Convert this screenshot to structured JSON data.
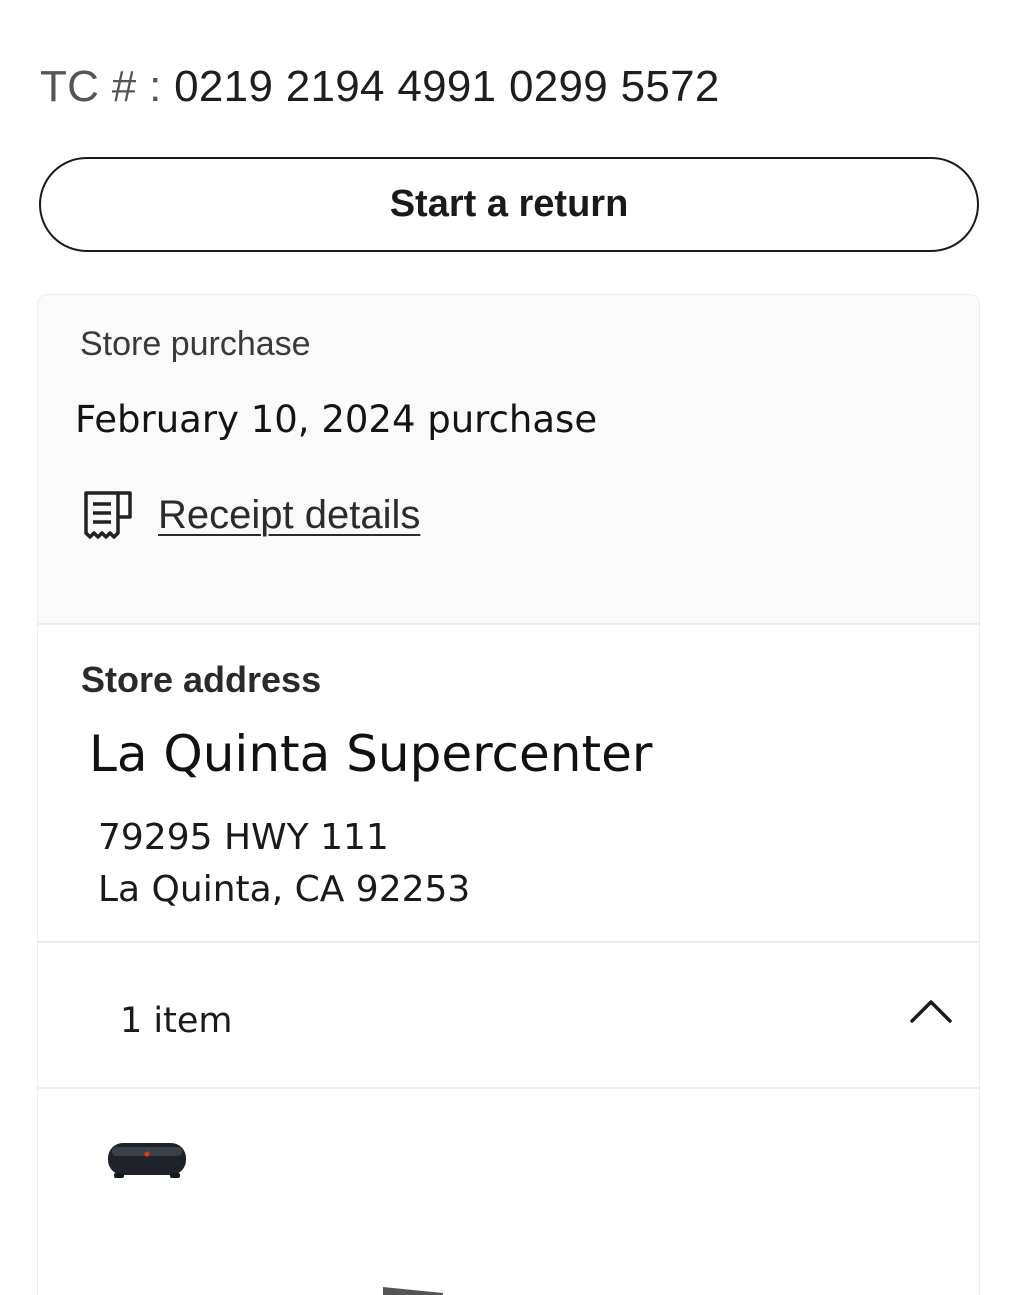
{
  "transaction": {
    "tc_label": "TC # :",
    "tc_number": "0219 2194 4991 0299 5572"
  },
  "actions": {
    "start_return_label": "Start a return"
  },
  "purchase": {
    "type_label": "Store purchase",
    "date_text": "February 10, 2024 purchase",
    "receipt_link_label": "Receipt details",
    "receipt_icon": "receipt-icon"
  },
  "store": {
    "section_label": "Store address",
    "name": "La Quinta Supercenter",
    "address_line1": "79295 HWY 111",
    "address_line2": "La Quinta, CA 92253"
  },
  "items": {
    "count_label": "1 item",
    "toggle_icon": "chevron-up-icon",
    "product_image_icon": "speaker-product-image"
  },
  "colors": {
    "text_primary": "#1a1a1a",
    "card_background": "#fafafa",
    "divider": "#ececec",
    "product_accent": "#d9352b"
  }
}
